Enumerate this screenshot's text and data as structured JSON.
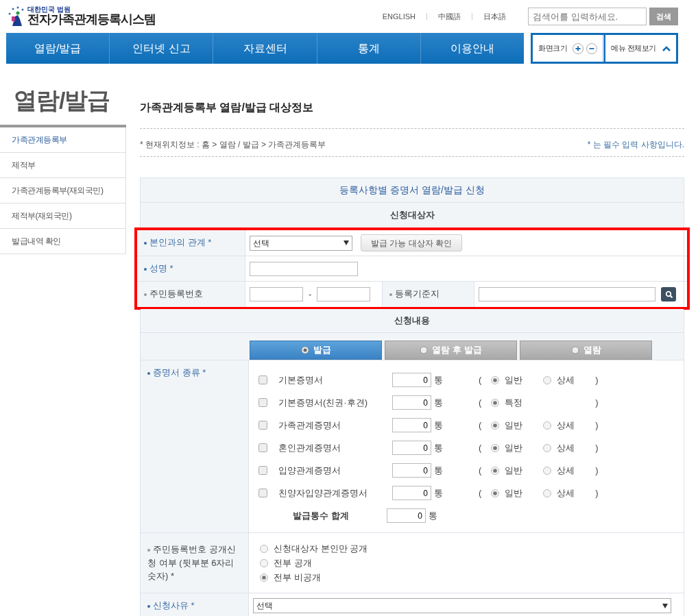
{
  "header": {
    "org": "대한민국 법원",
    "system": "전자가족관계등록시스템",
    "languages": [
      "ENGLISH",
      "中國語",
      "日本語"
    ],
    "search": {
      "placeholder": "검색어를 입력하세요.",
      "button": "검색"
    }
  },
  "nav": {
    "items": [
      "열람/발급",
      "인터넷 신고",
      "자료센터",
      "통계",
      "이용안내"
    ],
    "zoom_label": "화면크기",
    "all_menu": "메뉴 전체보기"
  },
  "sidebar": {
    "title": "열람/발급",
    "items": [
      {
        "label": "가족관계등록부",
        "selected": true
      },
      {
        "label": "제적부",
        "selected": false
      },
      {
        "label": "가족관계등록부(재외국민)",
        "selected": false
      },
      {
        "label": "제적부(재외국민)",
        "selected": false
      },
      {
        "label": "발급내역 확인",
        "selected": false
      }
    ]
  },
  "page": {
    "title": "가족관계등록부 열람/발급 대상정보",
    "breadcrumb": "* 현재위치정보 : 홈 > 열람 / 발급 > 가족관계등록부",
    "required_note": "* 는 필수 입력 사항입니다."
  },
  "form": {
    "title": "등록사항별 증명서 열람/발급 신청",
    "applicant_heading": "신청대상자",
    "relation": {
      "label": "본인과의 관계 *",
      "required": true,
      "value": "선택",
      "button": "발급 가능 대상자 확인"
    },
    "name": {
      "label": "성명 *",
      "required": true
    },
    "rrn": {
      "label": "주민등록번호",
      "required": false,
      "separator": "-"
    },
    "registry": {
      "label": "등록기준지",
      "required": false
    },
    "content_heading": "신청내용",
    "modes": [
      {
        "label": "발급",
        "selected": true
      },
      {
        "label": "열람 후 발급",
        "selected": false
      },
      {
        "label": "열람",
        "selected": false
      }
    ],
    "certificates": {
      "label": "증명서 종류 *",
      "required": true,
      "items": [
        {
          "name": "기본증명서",
          "checked": false,
          "count": "0",
          "unit": "통",
          "open": "(",
          "close": ")",
          "options": [
            {
              "label": "일반",
              "selected": true
            },
            {
              "label": "상세",
              "selected": false
            }
          ]
        },
        {
          "name": "기본증명서(친권·후견)",
          "checked": false,
          "count": "0",
          "unit": "통",
          "open": "(",
          "close": ")",
          "options": [
            {
              "label": "특정",
              "selected": true
            }
          ]
        },
        {
          "name": "가족관계증명서",
          "checked": false,
          "count": "0",
          "unit": "통",
          "open": "(",
          "close": ")",
          "options": [
            {
              "label": "일반",
              "selected": true
            },
            {
              "label": "상세",
              "selected": false
            }
          ]
        },
        {
          "name": "혼인관계증명서",
          "checked": false,
          "count": "0",
          "unit": "통",
          "open": "(",
          "close": ")",
          "options": [
            {
              "label": "일반",
              "selected": true
            },
            {
              "label": "상세",
              "selected": false
            }
          ]
        },
        {
          "name": "입양관계증명서",
          "checked": false,
          "count": "0",
          "unit": "통",
          "open": "(",
          "close": ")",
          "options": [
            {
              "label": "일반",
              "selected": true
            },
            {
              "label": "상세",
              "selected": false
            }
          ]
        },
        {
          "name": "친양자입양관계증명서",
          "checked": false,
          "count": "0",
          "unit": "통",
          "open": "(",
          "close": ")",
          "options": [
            {
              "label": "일반",
              "selected": true
            },
            {
              "label": "상세",
              "selected": false
            }
          ]
        }
      ],
      "total": {
        "label": "발급통수 합계",
        "count": "0",
        "unit": "통"
      }
    },
    "disclosure": {
      "label": "주민등록번호 공개신청 여부 (뒷부분 6자리 숫자) *",
      "required": false,
      "options": [
        {
          "label": "신청대상자 본인만 공개",
          "selected": false
        },
        {
          "label": "전부 공개",
          "selected": false
        },
        {
          "label": "전부 비공개",
          "selected": true
        }
      ]
    },
    "reason": {
      "label": "신청사유 *",
      "required": true,
      "value": "선택"
    }
  }
}
